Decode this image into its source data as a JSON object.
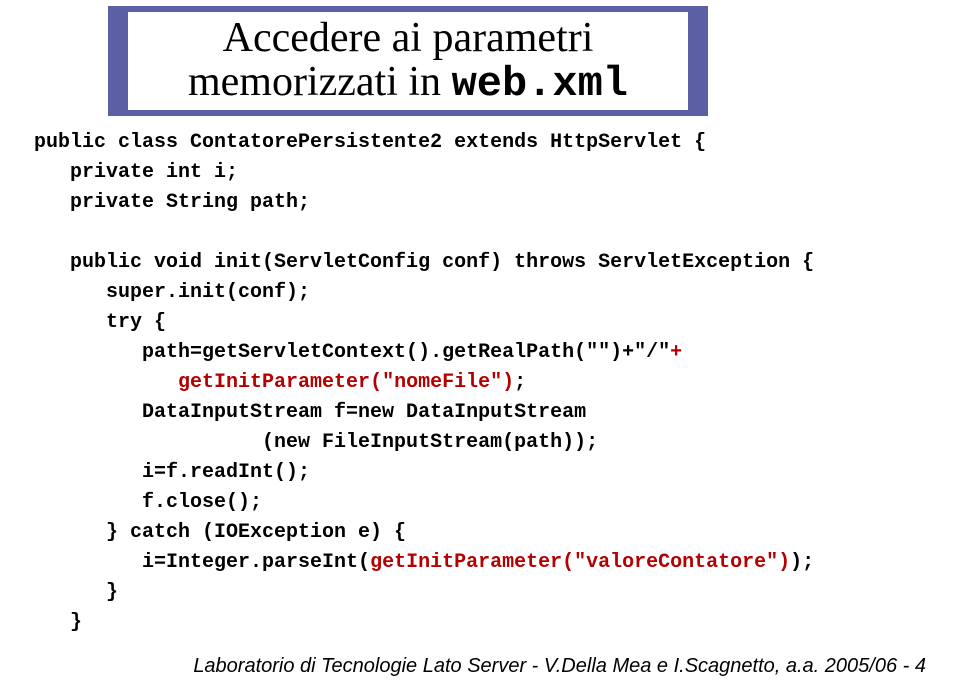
{
  "header": {
    "title_line1": "Accedere ai parametri",
    "title_line2_pre": "memorizzati in ",
    "title_line2_mono": "web.xml"
  },
  "code": {
    "l1": "public class ContatorePersistente2 extends HttpServlet {",
    "l2": "   private int i;",
    "l3": "   private String path;",
    "l4": "",
    "l5": "   public void init(ServletConfig conf) throws ServletException {",
    "l6": "      super.init(conf);",
    "l7": "      try {",
    "l8a": "         path=getServletContext().getRealPath(\"\")+\"/\"",
    "l8b": "+",
    "l9a": "            ",
    "l9b": "getInitParameter(\"nomeFile\")",
    "l9c": ";",
    "l10": "         DataInputStream f=new DataInputStream",
    "l11": "                   (new FileInputStream(path));",
    "l12": "         i=f.readInt();",
    "l13": "         f.close();",
    "l14": "      } catch (IOException e) {",
    "l15a": "         i=Integer.parseInt(",
    "l15b": "getInitParameter(\"valoreContatore\")",
    "l15c": ");",
    "l16": "      }",
    "l17": "   }"
  },
  "footer": {
    "text": "Laboratorio di Tecnologie Lato Server - V.Della Mea e I.Scagnetto, a.a. 2005/06 - 4"
  }
}
